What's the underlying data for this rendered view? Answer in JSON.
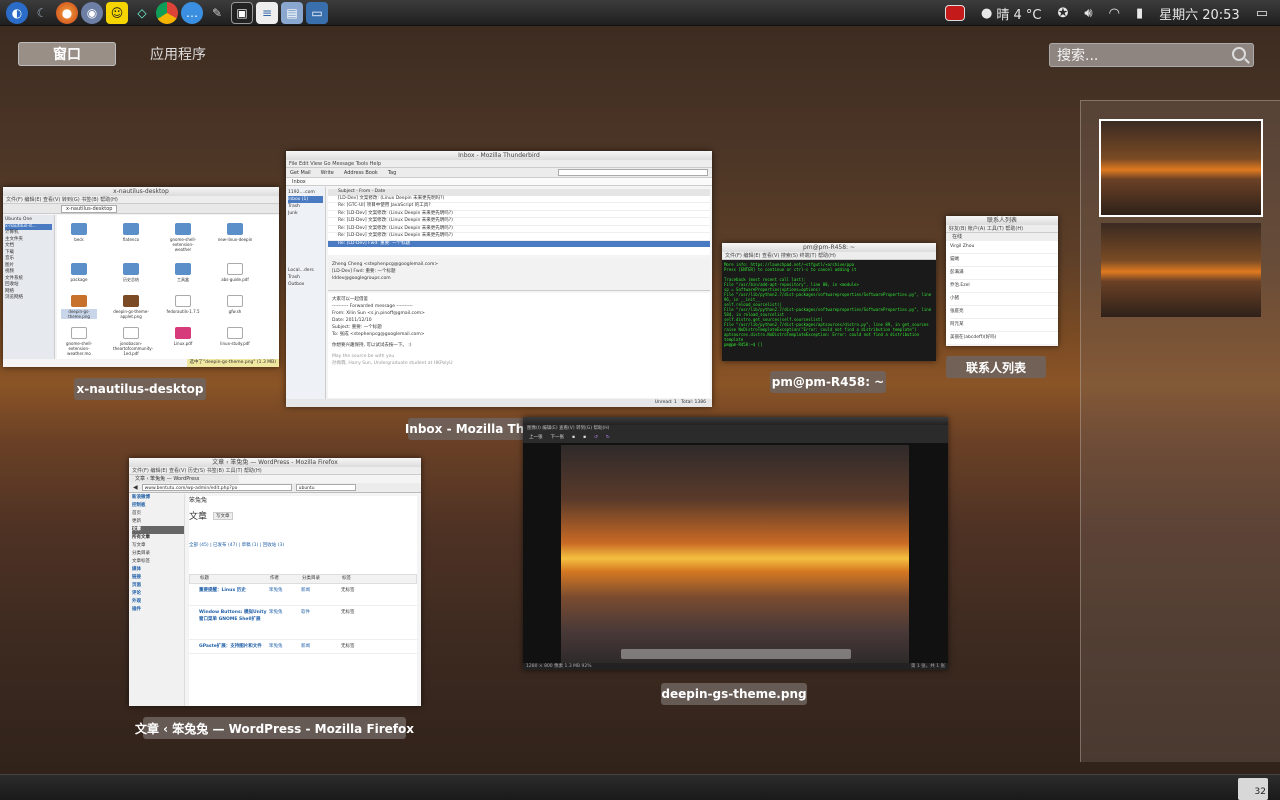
{
  "panel": {
    "launchers": [
      "deepin-logo-icon",
      "moon-icon",
      "firefox-icon",
      "pidgin-icon",
      "qq-icon",
      "diamond-icon",
      "chrome-icon",
      "chat-bubble-icon",
      "game-icon",
      "terminal-icon",
      "document-icon",
      "file-manager-icon",
      "screen-icon"
    ],
    "weather": "晴 4 °C",
    "clock": "星期六 20:53"
  },
  "overview": {
    "tabs": [
      {
        "label": "窗口",
        "active": true
      },
      {
        "label": "应用程序",
        "active": false
      }
    ],
    "search_placeholder": "搜索..."
  },
  "windows": {
    "nautilus": {
      "title": "x-nautilus-desktop",
      "caption": "x-nautilus-desktop",
      "path": "x-nautilus-desktop",
      "sidebar": [
        "Ubuntu One",
        "x-nautilus-d...",
        "计算机",
        "主文件夹",
        "文档",
        "下载",
        "音乐",
        "图片",
        "视频",
        "文件系统",
        "回收站",
        "网络",
        "浏览网络"
      ],
      "files": [
        "beck",
        "fiatenco",
        "gnome-shell-extension-weather",
        "new-linux-deepin",
        "package",
        "历史总结",
        "工具盒",
        "abs-guide.pdf",
        "deepin-gs-theme.png",
        "deepin-gs-theme-applet.png",
        "fedorautils-1.7.5",
        "gfw.sh",
        "gnome-shell-extension-weather.mo",
        "jonobacon-theartofcommunity-1ed.pdf",
        "Linux.pdf",
        "linux-study.pdf"
      ],
      "status": "选中了\"deepin-gs-theme.png\" (1.3 MB)"
    },
    "thunderbird": {
      "title": "Inbox - Mozilla Thunderbird",
      "caption": "Inbox - Mozilla Thunderbird",
      "toolbar": [
        "Get Mail",
        "Write",
        "Address Book",
        "Tag"
      ],
      "tab": "Inbox",
      "folders": [
        "1192....com",
        "Inbox (1)",
        "Trash",
        "Junk",
        "Local...ders",
        "Trash",
        "Outbox"
      ],
      "messages": [
        "[LD-Dev] 文案修改: (Linux Deepin 未来更先明吗?)",
        "Re: [GTC-UI] 项目中使用 JavaScript 的工具?",
        "Re: [LD-Dev] 文案修改: (Linux Deepin 未来更先明吗?)",
        "Re: [LD-Dev] 文案修改: (Linux Deepin 未来更先明吗?)",
        "Re: [LD-Dev] 文案修改: (Linux Deepin 未来更先明吗?)",
        "Re: [LD-Dev] 文案修改: (Linux Deepin 未来更先明吗?)",
        "Re: [LD-Dev] Fwd: 重要: 一个标题"
      ],
      "from": "Zheng Cheng <stephenpcg@googlemail.com>",
      "subject": "[LD-Dev] Fwd: 重要: 一个标题",
      "to": "lddev@googlegroups.com",
      "body_lines": [
        "大家可以一起借鉴",
        "---------- Forwarded message ----------",
        "From: Xilin Sun <s.jn.pinoff@gmail.com>",
        "Date: 2011/12/10",
        "Subject: 重要: 一个标题",
        "To: 张成 <stephenpcg@googlemail.com>",
        "你想要兴趣保持, 可以试试去按一下。 :)",
        "May the source be with you",
        "孙佩霖, Harry Sun, Undergraduate student at HKPolyU"
      ],
      "status_unread": "Unread: 1",
      "status_total": "Total: 1386"
    },
    "terminal": {
      "caption": "pm@pm-R458: ~",
      "title": "pm@pm-R458: ~",
      "lines": [
        "More info: https://launchpad.net/~stfgutl/+archive/ppa",
        "Press [ENTER] to continue or ctrl-c to cancel adding it",
        "",
        "Traceback (most recent call last):",
        "  File \"/usr/bin/add-apt-repository\", line 88, in <module>",
        "    sp = SoftwareProperties(options=options)",
        "  File \"/usr/lib/python2.7/dist-packages/softwareproperties/SoftwareProperties.py\", line 96, in __init__",
        "    self.reload_sourcelist()",
        "  File \"/usr/lib/python2.7/dist-packages/softwareproperties/SoftwareProperties.py\", line 584, in reload_sourcelist",
        "    self.distro.get_sources(self.sourceslist)",
        "  File \"/usr/lib/python2.7/dist-packages/aptsources/distro.py\", line 89, in get_sources",
        "    raise NoDistroTemplateException(\"Error: could not find a distribution template\")",
        "aptsources.distro.NoDistroTemplateException: Error: could not find a distribution template",
        "pm@pm-R458:~$ []"
      ]
    },
    "contacts": {
      "caption": "联系人列表",
      "title": "联系人列表",
      "status": "在线",
      "items": [
        "Virgil Zhou",
        "猫贼",
        "彭满满",
        "乔治.Ezel",
        "小猪",
        "张庭亮",
        "阿元某",
        "美丽在(abcdeff)(好吗)"
      ]
    },
    "firefox": {
      "caption": "文章 ‹ 笨兔兔 — WordPress - Mozilla Firefox",
      "title": "文章 ‹ 笨兔兔 — WordPress - Mozilla Firefox",
      "tab": "文章 ‹ 笨兔兔 — WordPress",
      "url": "www.bentutu.com/wp-admin/edit.php?po",
      "search": "ubuntu",
      "site": "笨兔兔",
      "heading": "文章",
      "add_new": "写文章",
      "sidebar": [
        "新浪微博",
        "控制板",
        "首页",
        "更新",
        "文章",
        "所有文章",
        "写文章",
        "分类目录",
        "文章标签",
        "媒体",
        "链接",
        "页面",
        "评论",
        "外观",
        "插件"
      ],
      "filters": "全部 (45) | 已发布 (47) | 草稿 (1) | 回收站 (3)",
      "columns": [
        "标题",
        "作者",
        "分类目录",
        "标签"
      ],
      "posts": [
        {
          "title": "重要提醒：Linux 历史",
          "author": "笨兔兔",
          "cat": "新闻",
          "tag": "无标签"
        },
        {
          "title": "Window Buttons: 模拟Unity窗口菜单 GNOME Shell扩展",
          "author": "笨兔兔",
          "cat": "软件",
          "tag": "无标签"
        },
        {
          "title": "GPaste扩展：支持图片和文件",
          "author": "笨兔兔",
          "cat": "新闻",
          "tag": "无标签"
        }
      ]
    },
    "viewer": {
      "caption": "deepin-gs-theme.png",
      "toolbar": [
        "上一张",
        "下一张"
      ],
      "status": "1280 × 800 像素 1.3 MB  92%",
      "page": "第 1 张，共 1 张"
    }
  },
  "workspaces": [
    {
      "name": "workspace-1",
      "current": true
    },
    {
      "name": "workspace-2",
      "current": false
    }
  ],
  "dock": {
    "trash_count": "32"
  }
}
